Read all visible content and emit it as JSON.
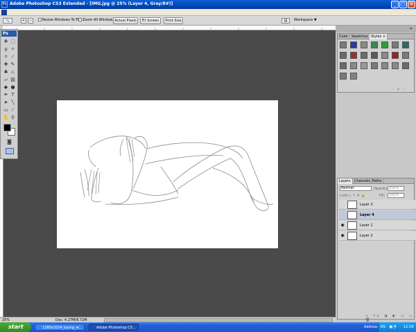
{
  "window": {
    "title": "Adobe Photoshop CS3 Extended - [IMG.jpg @ 25% (Layer 4, Gray/8#)]",
    "controls": [
      "_",
      "▢",
      "✕"
    ]
  },
  "options_bar": {
    "resize_windows": "Resize Windows To Fit",
    "zoom_all": "Zoom All Windows",
    "actual_pixels": "Actual Pixels",
    "fit_screen": "Fit Screen",
    "print_size": "Print Size",
    "workspace": "Workspace ▼"
  },
  "toolbox": {
    "logo": "Ps"
  },
  "status": {
    "zoom": "25%",
    "doc": "Doc: 4.27M/8.72M"
  },
  "color_panel": {
    "tabs": [
      "Color",
      "Swatches",
      "Styles"
    ],
    "close": "×",
    "style_colors": [
      "#7a7a7a",
      "#2a3aa0",
      "#8a8a8a",
      "#3a8a4a",
      "#2aa030",
      "#7a7a7a",
      "#2a6a6a",
      "#6a6a6a",
      "#a03030",
      "#6a6a6a",
      "#5a5a5a",
      "#8a8a8a",
      "#a02020",
      "#7a7a7a",
      "#6a6a6a",
      "#8a8a8a",
      "#9a9a9a",
      "#7a7a7a",
      "#8a8a8a",
      "#8a8a8a",
      "#6a6a6a",
      "#7a7a7a",
      "#7a8a7a"
    ]
  },
  "layers_panel": {
    "tabs": [
      "Layers",
      "Channels",
      "Paths"
    ],
    "blend": "Normal",
    "opacity_label": "Opacity:",
    "opacity": "100%",
    "lock_label": "Lock:",
    "fill_label": "Fill:",
    "fill": "100%",
    "layers": [
      {
        "name": "Layer 3",
        "visible": false,
        "selected": false
      },
      {
        "name": "Layer 4",
        "visible": false,
        "selected": true
      },
      {
        "name": "Layer 1",
        "visible": true,
        "selected": false
      },
      {
        "name": "Layer 2",
        "visible": true,
        "selected": false
      }
    ]
  },
  "taskbar": {
    "start": "start",
    "tasks": [
      "1280x1024_laying_w...",
      "Adobe Photoshop CS..."
    ],
    "address": "Address",
    "lang": "EN",
    "clock": "12:58"
  }
}
